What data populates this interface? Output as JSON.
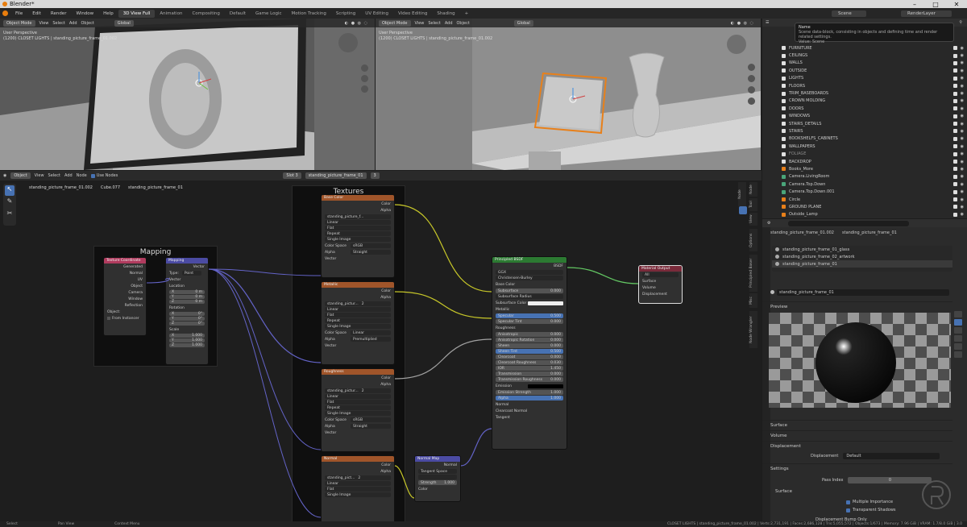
{
  "title": "Blender*",
  "menus": [
    "File",
    "Edit",
    "Render",
    "Window",
    "Help"
  ],
  "workspaces": [
    "3D View Full",
    "Animation",
    "Compositing",
    "Default",
    "Game Logic",
    "Motion Tracking",
    "Scripting",
    "UV Editing",
    "Video Editing",
    "Shading"
  ],
  "scene": "Scene",
  "view_layer": "RenderLayer",
  "viewport_left": {
    "mode": "Object Mode",
    "menus": [
      "View",
      "Select",
      "Add",
      "Object"
    ],
    "transform": "Global",
    "line1": "User Perspective",
    "line2": "(1200) CLOSET LIGHTS | standing_picture_frame_01.002"
  },
  "viewport_right": {
    "mode": "Object Mode",
    "menus": [
      "View",
      "Select",
      "Add",
      "Object"
    ],
    "transform": "Global",
    "line1": "User Perspective",
    "line2": "(1200) CLOSET LIGHTS | standing_picture_frame_01.002"
  },
  "node_header": {
    "type": "Object",
    "menus": [
      "View",
      "Select",
      "Add",
      "Node"
    ],
    "use_nodes": "Use Nodes",
    "slot": "Slot 3",
    "material": "standing_picture_frame_01",
    "users": "3"
  },
  "breadcrumb": [
    "standing_picture_frame_01.002",
    "Cube.077",
    "standing_picture_frame_01"
  ],
  "frames": {
    "mapping": "Mapping",
    "textures": "Textures"
  },
  "tex_coord": {
    "title": "Texture Coordinate",
    "outputs": [
      "Generated",
      "Normal",
      "UV",
      "Object",
      "Camera",
      "Window",
      "Reflection"
    ],
    "object_label": "Object:",
    "from_instancer": "From Instancer"
  },
  "mapping": {
    "title": "Mapping",
    "output": "Vector",
    "type_label": "Type:",
    "type_value": "Point",
    "vector": "Vector",
    "location": "Location",
    "loc": [
      [
        "X",
        "0 m"
      ],
      [
        "Y",
        "0 m"
      ],
      [
        "Z",
        "0 m"
      ]
    ],
    "rotation": "Rotation",
    "rot": [
      [
        "X",
        "0°"
      ],
      [
        "Y",
        "0°"
      ],
      [
        "Z",
        "0°"
      ]
    ],
    "scale": "Scale",
    "scl": [
      [
        "X",
        "1.000"
      ],
      [
        "Y",
        "1.000"
      ],
      [
        "Z",
        "1.000"
      ]
    ]
  },
  "tex_nodes": [
    {
      "title": "Base Color",
      "image": "standing_picture_f...",
      "users": "",
      "interp": "Linear",
      "proj": "Flat",
      "ext": "Repeat",
      "src": "Single Image",
      "cs_label": "Color Space",
      "cs": "sRGB",
      "alpha_label": "Alpha",
      "alpha": "Straight"
    },
    {
      "title": "Metallic",
      "image": "standing_pictur...",
      "users": "2",
      "interp": "Linear",
      "proj": "Flat",
      "ext": "Repeat",
      "src": "Single Image",
      "cs_label": "Color Space",
      "cs": "Linear",
      "alpha_label": "Alpha",
      "alpha": "Premultiplied"
    },
    {
      "title": "Roughness",
      "image": "standing_pictur...",
      "users": "2",
      "interp": "Linear",
      "proj": "Flat",
      "ext": "Repeat",
      "src": "Single Image",
      "cs_label": "Color Space",
      "cs": "sRGB",
      "alpha_label": "Alpha",
      "alpha": "Straight"
    },
    {
      "title": "Normal",
      "image": "standing_pict...",
      "users": "2",
      "interp": "Linear",
      "proj": "Flat",
      "ext": "Single Image",
      "src": "",
      "cs_label": "",
      "cs": "",
      "alpha_label": "",
      "alpha": ""
    }
  ],
  "tex_sockets": {
    "color": "Color",
    "alpha": "Alpha",
    "vector": "Vector"
  },
  "normal_map": {
    "title": "Normal Map",
    "output": "Normal",
    "space": "Tangent Space",
    "strength_label": "Strength",
    "strength": "1.000",
    "color": "Color"
  },
  "bsdf": {
    "title": "Principled BSDF",
    "output": "BSDF",
    "dist": "GGX",
    "sss": "Christensen-Burley",
    "base_color": "Base Color",
    "subsurface": [
      "Subsurface",
      "0.000"
    ],
    "sss_radius": "Subsurface Radius",
    "sss_color": "Subsurface Color",
    "metallic": "Metallic",
    "rows": [
      [
        "Specular",
        "0.500"
      ],
      [
        "Specular Tint",
        "0.000"
      ]
    ],
    "roughness": "Roughness",
    "rows2": [
      [
        "Anisotropic",
        "0.000"
      ],
      [
        "Anisotropic Rotation",
        "0.000"
      ],
      [
        "Sheen",
        "0.000"
      ],
      [
        "Sheen Tint",
        "0.500"
      ],
      [
        "Clearcoat",
        "0.000"
      ],
      [
        "Clearcoat Roughness",
        "0.030"
      ],
      [
        "IOR",
        "1.450"
      ],
      [
        "Transmission",
        "0.000"
      ],
      [
        "Transmission Roughness",
        "0.000"
      ]
    ],
    "emission": "Emission",
    "rows3": [
      [
        "Emission Strength",
        "1.000"
      ],
      [
        "Alpha",
        "1.000"
      ]
    ],
    "tail": [
      "Normal",
      "Clearcoat Normal",
      "Tangent"
    ]
  },
  "mat_out": {
    "title": "Material Output",
    "target": "All",
    "inputs": [
      "Surface",
      "Volume",
      "Displacement"
    ]
  },
  "side_tabs": [
    "Node",
    "Tool",
    "View",
    "Options",
    "Principled Baker",
    "Misc",
    "Node Wrangler"
  ],
  "tooltip": {
    "title": "Name",
    "desc": "Scene data-block, consisting in objects and defining time and render related settings.",
    "value": "Value: Scene"
  },
  "outliner": [
    "FURNITURE",
    "CEILINGS",
    "WALLS",
    "OUTSIDE",
    "LIGHTS",
    "FLOORS",
    "TRIM_BASEBOARDS",
    "CROWN MOLDING",
    "DOORS",
    "WINDOWS",
    "STAIRS_DETAILS",
    "STAIRS",
    "BOOKSHELFS_CABINETS",
    "WALLPAPERS",
    "FOLIAGE",
    "BACKDROP",
    "Books_More",
    "Camera.LivingRoom",
    "Camera.Top.Down",
    "Camera.Top.Down.001",
    "Circle",
    "GROUND PLANE",
    "Outside_Lamp"
  ],
  "props": {
    "object": "standing_picture_frame_01.002",
    "material": "standing_picture_frame_01",
    "slots": [
      "standing_picture_frame_01_glass",
      "standing_picture_frame_02_artwork",
      "standing_picture_frame_01"
    ],
    "mat_name": "standing_picture_frame_01",
    "preview": "Preview",
    "sections": [
      "Surface",
      "Volume",
      "Displacement"
    ],
    "disp_label": "Displacement",
    "disp_value": "Default",
    "settings": "Settings",
    "pass_label": "Pass Index",
    "pass_value": "0",
    "surface": "Surface",
    "mult": "Multiple Importance",
    "transp": "Transparent Shadows",
    "disp_only": "Displacement Bump Only"
  },
  "status": {
    "select": "Select",
    "pan": "Pan View",
    "ctx": "Context Menu",
    "info": "CLOSET LIGHTS | standing_picture_frame_01.002 | Verts:2,731,191 | Faces:2,686,128 | Tris:5,055,572 | Objects:1/673 | Memory: 7.96 GiB | VRAM: 1.7/8.0 GiB | 3.0"
  }
}
